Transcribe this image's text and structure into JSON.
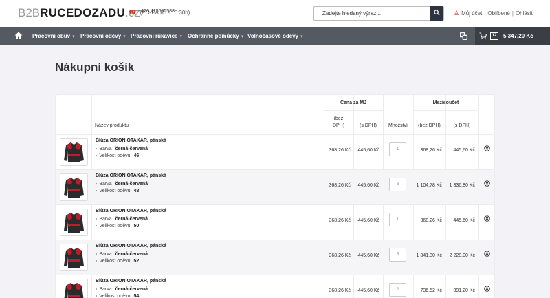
{
  "header": {
    "logo_prefix": "B2B",
    "logo_main": "RUCEDOZADU",
    "logo_suffix": ".cz",
    "phone": "+420 415655583",
    "hours": "(PO-PÁ 8h - 16:30h)",
    "search_placeholder": "Zadejte hledaný výraz...",
    "links": {
      "account": "Můj účet",
      "favorites": "Oblíbené",
      "logout": "Ohlásit"
    }
  },
  "nav": {
    "items": [
      {
        "label": "Pracovní obuv"
      },
      {
        "label": "Pracovní oděvy"
      },
      {
        "label": "Pracovní rukavice"
      },
      {
        "label": "Ochranné pomůcky"
      },
      {
        "label": "Volnočasové oděvy"
      }
    ],
    "cart_count": "12",
    "cart_total": "5 347,20 Kč"
  },
  "page_title": "Nákupní košík",
  "table": {
    "headers": {
      "product": "Název produktu",
      "unit_price": "Cena za MJ",
      "excl_vat": "(bez DPH)",
      "excl_vat_l1": "(bez",
      "excl_vat_l2": "DPH)",
      "incl_vat": "(s DPH)",
      "quantity": "Množství",
      "subtotal": "Mezisoučet"
    },
    "attr_color_label": "Barva",
    "attr_size_label": "Velikost oděvu",
    "rows": [
      {
        "name": "Blůza ORION OTAKAR, pánská",
        "color": "černá-červená",
        "size": "46",
        "price_excl": "368,26 Kč",
        "price_incl": "445,60 Kč",
        "qty": "1",
        "sub_excl": "368,26 Kč",
        "sub_incl": "445,60 Kč"
      },
      {
        "name": "Blůza ORION OTAKAR, pánská",
        "color": "černá-červená",
        "size": "48",
        "price_excl": "368,26 Kč",
        "price_incl": "445,60 Kč",
        "qty": "3",
        "sub_excl": "1 104,78 Kč",
        "sub_incl": "1 336,80 Kč"
      },
      {
        "name": "Blůza ORION OTAKAR, pánská",
        "color": "černá-červená",
        "size": "50",
        "price_excl": "368,26 Kč",
        "price_incl": "445,60 Kč",
        "qty": "1",
        "sub_excl": "368,26 Kč",
        "sub_incl": "445,60 Kč"
      },
      {
        "name": "Blůza ORION OTAKAR, pánská",
        "color": "černá-červená",
        "size": "52",
        "price_excl": "368,26 Kč",
        "price_incl": "445,60 Kč",
        "qty": "5",
        "sub_excl": "1 841,30 Kč",
        "sub_incl": "2 228,00 Kč"
      },
      {
        "name": "Blůza ORION OTAKAR, pánská",
        "color": "černá-červená",
        "size": "54",
        "price_excl": "368,26 Kč",
        "price_incl": "445,60 Kč",
        "qty": "2",
        "sub_excl": "736,52 Kč",
        "sub_incl": "891,20 Kč"
      }
    ]
  }
}
